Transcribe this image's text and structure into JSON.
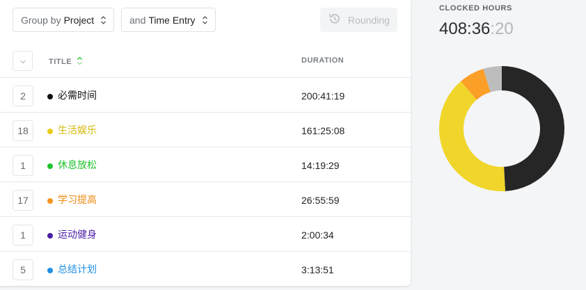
{
  "toolbar": {
    "group_prefix": "Group by",
    "group_value": "Project",
    "entry_prefix": "and",
    "entry_value": "Time Entry",
    "rounding_label": "Rounding"
  },
  "table": {
    "headers": {
      "title": "TITLE",
      "duration": "DURATION"
    },
    "rows": [
      {
        "count": "2",
        "name": "必需时间",
        "duration": "200:41:19",
        "color": "#111111"
      },
      {
        "count": "18",
        "name": "生活娱乐",
        "duration": "161:25:08",
        "color": "#e8cc14"
      },
      {
        "count": "1",
        "name": "休息放松",
        "duration": "14:19:29",
        "color": "#1fc32b"
      },
      {
        "count": "17",
        "name": "学习提高",
        "duration": "26:55:59",
        "color": "#f39320"
      },
      {
        "count": "1",
        "name": "运动健身",
        "duration": "2:00:34",
        "color": "#4b1fa8"
      },
      {
        "count": "5",
        "name": "总结计划",
        "duration": "3:13:51",
        "color": "#1e8fe1"
      }
    ]
  },
  "summary": {
    "label": "CLOCKED HOURS",
    "value_main": "408:36",
    "value_seconds": ":20"
  },
  "chart_data": {
    "type": "pie",
    "style": "donut",
    "slices": [
      {
        "label": "必需时间",
        "value": 200.69,
        "color": "#262626"
      },
      {
        "label": "生活娱乐",
        "value": 161.42,
        "color": "#f0d62a"
      },
      {
        "label": "学习提高",
        "value": 26.93,
        "color": "#fb9f29"
      },
      {
        "label": "other",
        "value": 19.56,
        "color": "#bdbdbd"
      }
    ],
    "start": "top",
    "direction": "clockwise"
  }
}
